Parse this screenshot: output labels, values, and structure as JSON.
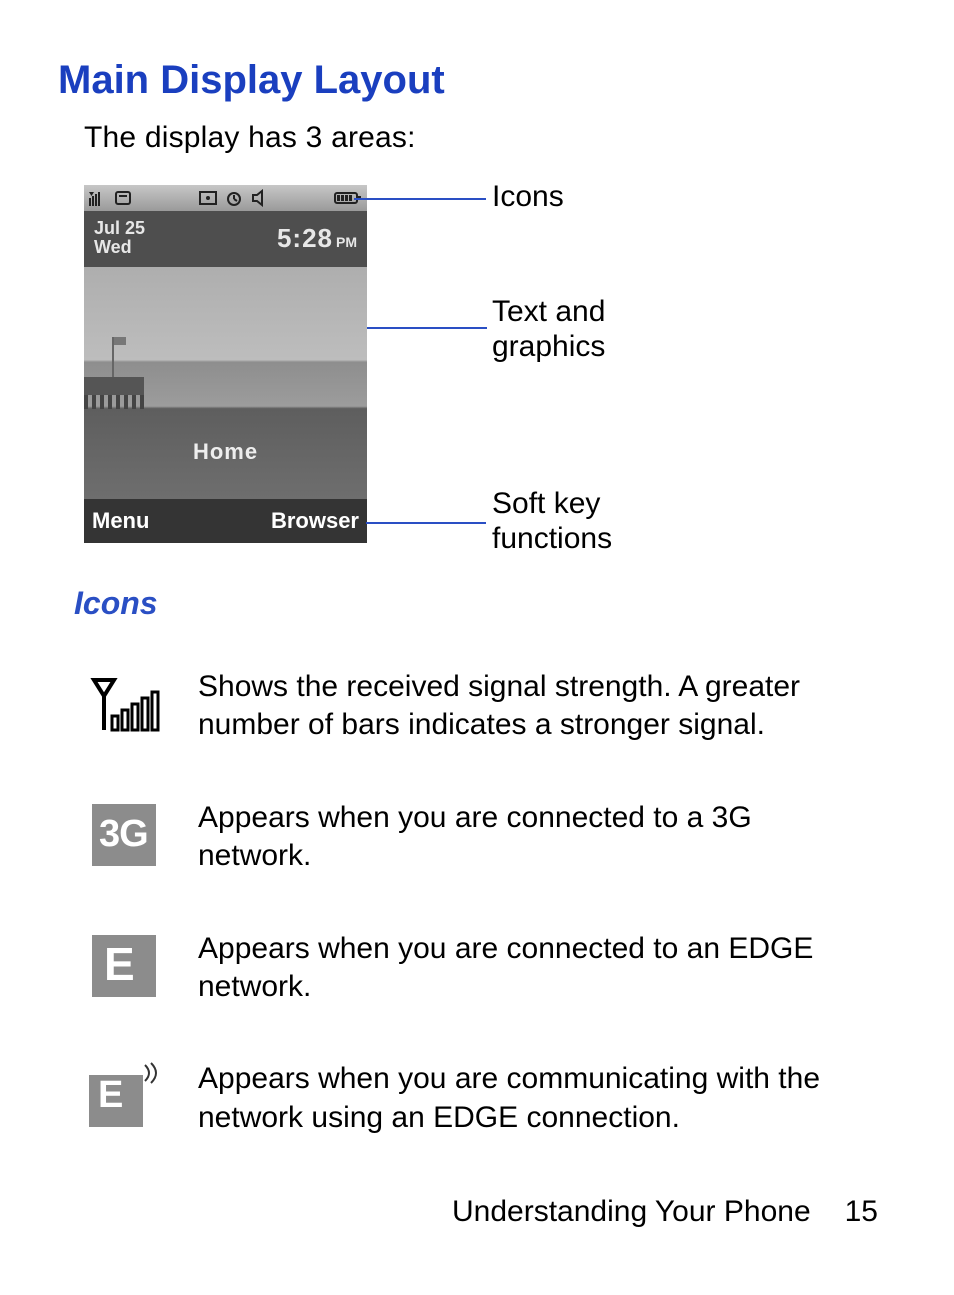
{
  "title": "Main Display Layout",
  "intro": "The display has 3 areas:",
  "phone": {
    "date_line1": "Jul 25",
    "date_line2": "Wed",
    "time": "5:28",
    "ampm": "PM",
    "home_label": "Home",
    "softkeys": {
      "left": "Menu",
      "right": "Browser"
    }
  },
  "callouts": {
    "icons": "Icons",
    "text_graphics_l1": "Text and",
    "text_graphics_l2": "graphics",
    "softkey_l1": "Soft key",
    "softkey_l2": "functions"
  },
  "subheading": "Icons",
  "icon_defs": [
    {
      "name": "signal-strength-icon",
      "desc": "Shows the received signal strength. A greater number of bars indicates a stronger signal."
    },
    {
      "name": "3g-network-icon",
      "desc": "Appears when you are connected to a 3G network."
    },
    {
      "name": "edge-network-icon",
      "desc": "Appears when you are connected to an EDGE network."
    },
    {
      "name": "edge-active-icon",
      "desc": "Appears when you are communicating with the network using an EDGE connection."
    }
  ],
  "footer": {
    "section": "Understanding Your Phone",
    "page": "15"
  }
}
